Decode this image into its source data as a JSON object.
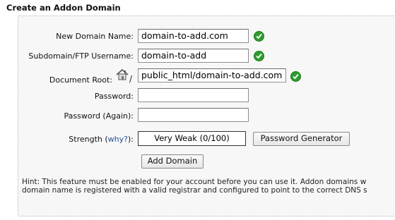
{
  "page": {
    "title": "Create an Addon Domain"
  },
  "form": {
    "new_domain": {
      "label": "New Domain Name:",
      "value": "domain-to-add.com"
    },
    "subdomain": {
      "label": "Subdomain/FTP Username:",
      "value": "domain-to-add"
    },
    "docroot": {
      "label": "Document Root:",
      "prefix": "/",
      "value": "public_html/domain-to-add.com"
    },
    "password": {
      "label": "Password:",
      "value": ""
    },
    "password_again": {
      "label": "Password (Again):",
      "value": ""
    },
    "strength": {
      "label": "Strength (",
      "why": "why?",
      "suffix": "):",
      "value": "Very Weak (0/100)"
    },
    "password_generator_label": "Password Generator",
    "add_domain_label": "Add Domain"
  },
  "hint": {
    "line1": "Hint: This feature must be enabled for your account before you can use it. Addon domains w",
    "line2": "domain name is registered with a valid registrar and configured to point to the correct DNS s"
  },
  "icons": {
    "valid": "check-circle-icon",
    "home": "home-icon"
  },
  "colors": {
    "valid": "#2e9c2e",
    "link": "#1f4e9c",
    "panel": "#f7f7f7"
  }
}
